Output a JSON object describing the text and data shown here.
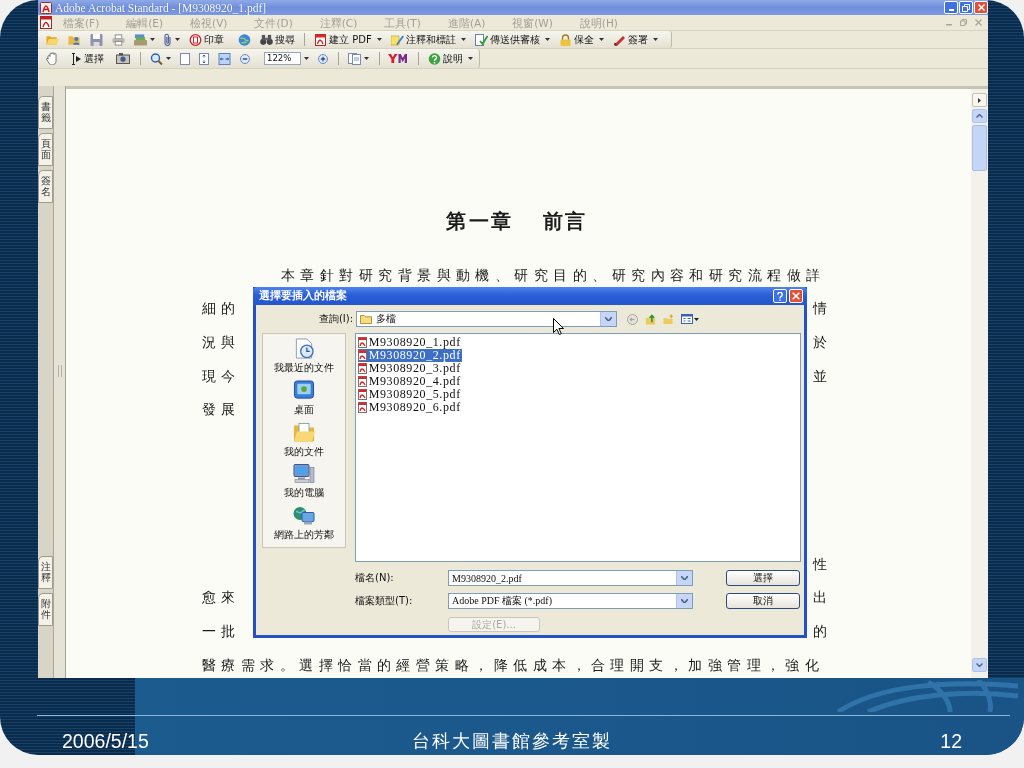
{
  "window": {
    "title": "Adobe Acrobat Standard - [M9308920_1.pdf]"
  },
  "menu": [
    {
      "label": "檔案(F)",
      "disabled": true
    },
    {
      "label": "編輯(E)",
      "disabled": true
    },
    {
      "label": "檢視(V)",
      "disabled": true
    },
    {
      "label": "文件(D)",
      "disabled": true
    },
    {
      "label": "注釋(C)",
      "disabled": true
    },
    {
      "label": "工具(T)",
      "disabled": true
    },
    {
      "label": "進階(A)",
      "disabled": true
    },
    {
      "label": "視窗(W)",
      "disabled": true
    },
    {
      "label": "說明(H)",
      "disabled": true
    }
  ],
  "toolbar_1": {
    "stamp": "印章",
    "search": "搜尋",
    "create_pdf": "建立 PDF",
    "comment": "注釋和標註",
    "review": "傳送供審核",
    "secure": "保全",
    "sign": "簽署"
  },
  "toolbar_2": {
    "select": "選擇",
    "zoom": "122%",
    "help": "說明"
  },
  "side_tabs": {
    "top": [
      "書籤",
      "頁面",
      "簽名"
    ],
    "bottom": [
      "注釋",
      "附件"
    ]
  },
  "document": {
    "heading": "第一章 前言",
    "paragraphs": [
      [
        {
          "left": "本章針對研究背景與動機、研究目的、研究內容和研究流程做詳"
        },
        {
          "left": "細的",
          "right": "情"
        },
        {
          "left": "況與",
          "right": "於"
        },
        {
          "left": "現今",
          "right": "並"
        },
        {
          "left": "發展"
        }
      ],
      [
        {
          "right": "性"
        },
        {
          "left": "愈來",
          "right": "出"
        },
        {
          "left": "一批",
          "right": "的"
        },
        {
          "left": "醫療需求。選擇恰當的經營策略，降低成本，合理開支，加強管理，強化"
        }
      ]
    ]
  },
  "dialog": {
    "title": "選擇要插入的檔案",
    "look_in": {
      "label": "查詢(I):",
      "value": "多檔"
    },
    "places": [
      "我最近的文件",
      "桌面",
      "我的文件",
      "我的電腦",
      "網路上的芳鄰"
    ],
    "files": [
      {
        "name": "M9308920_1.pdf",
        "selected": false
      },
      {
        "name": "M9308920_2.pdf",
        "selected": true
      },
      {
        "name": "M9308920_3.pdf",
        "selected": false
      },
      {
        "name": "M9308920_4.pdf",
        "selected": false
      },
      {
        "name": "M9308920_5.pdf",
        "selected": false
      },
      {
        "name": "M9308920_6.pdf",
        "selected": false
      }
    ],
    "file_name": {
      "label": "檔名(N):",
      "value": "M9308920_2.pdf"
    },
    "file_type": {
      "label": "檔案類型(T):",
      "value": "Adobe PDF 檔案 (*.pdf)"
    },
    "buttons": [
      {
        "label": "選擇",
        "disabled": false
      },
      {
        "label": "取消",
        "disabled": false
      },
      {
        "label": "設定(E)...",
        "disabled": true
      }
    ]
  },
  "footer": {
    "date": "2006/5/15",
    "title": "台科大圖書館參考室製",
    "page": "12"
  }
}
